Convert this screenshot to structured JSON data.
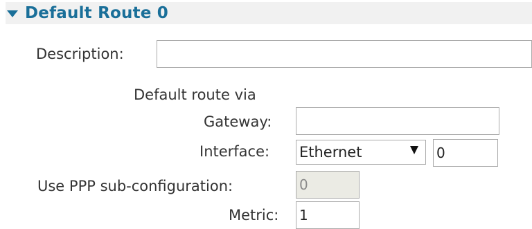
{
  "section": {
    "title": "Default Route 0",
    "icon": "caret-down-icon"
  },
  "form": {
    "description_label": "Description:",
    "description_value": "",
    "via_label": "Default route via",
    "gateway_label": "Gateway:",
    "gateway_value": "",
    "interface_label": "Interface:",
    "interface_selected": "Ethernet",
    "interface_number": "0",
    "ppp_label": "Use PPP sub-configuration:",
    "ppp_value": "0",
    "metric_label": "Metric:",
    "metric_value": "1"
  },
  "colors": {
    "accent": "#1a6f99",
    "header_bg": "#f1f1f1",
    "disabled_bg": "#ebebe4"
  }
}
